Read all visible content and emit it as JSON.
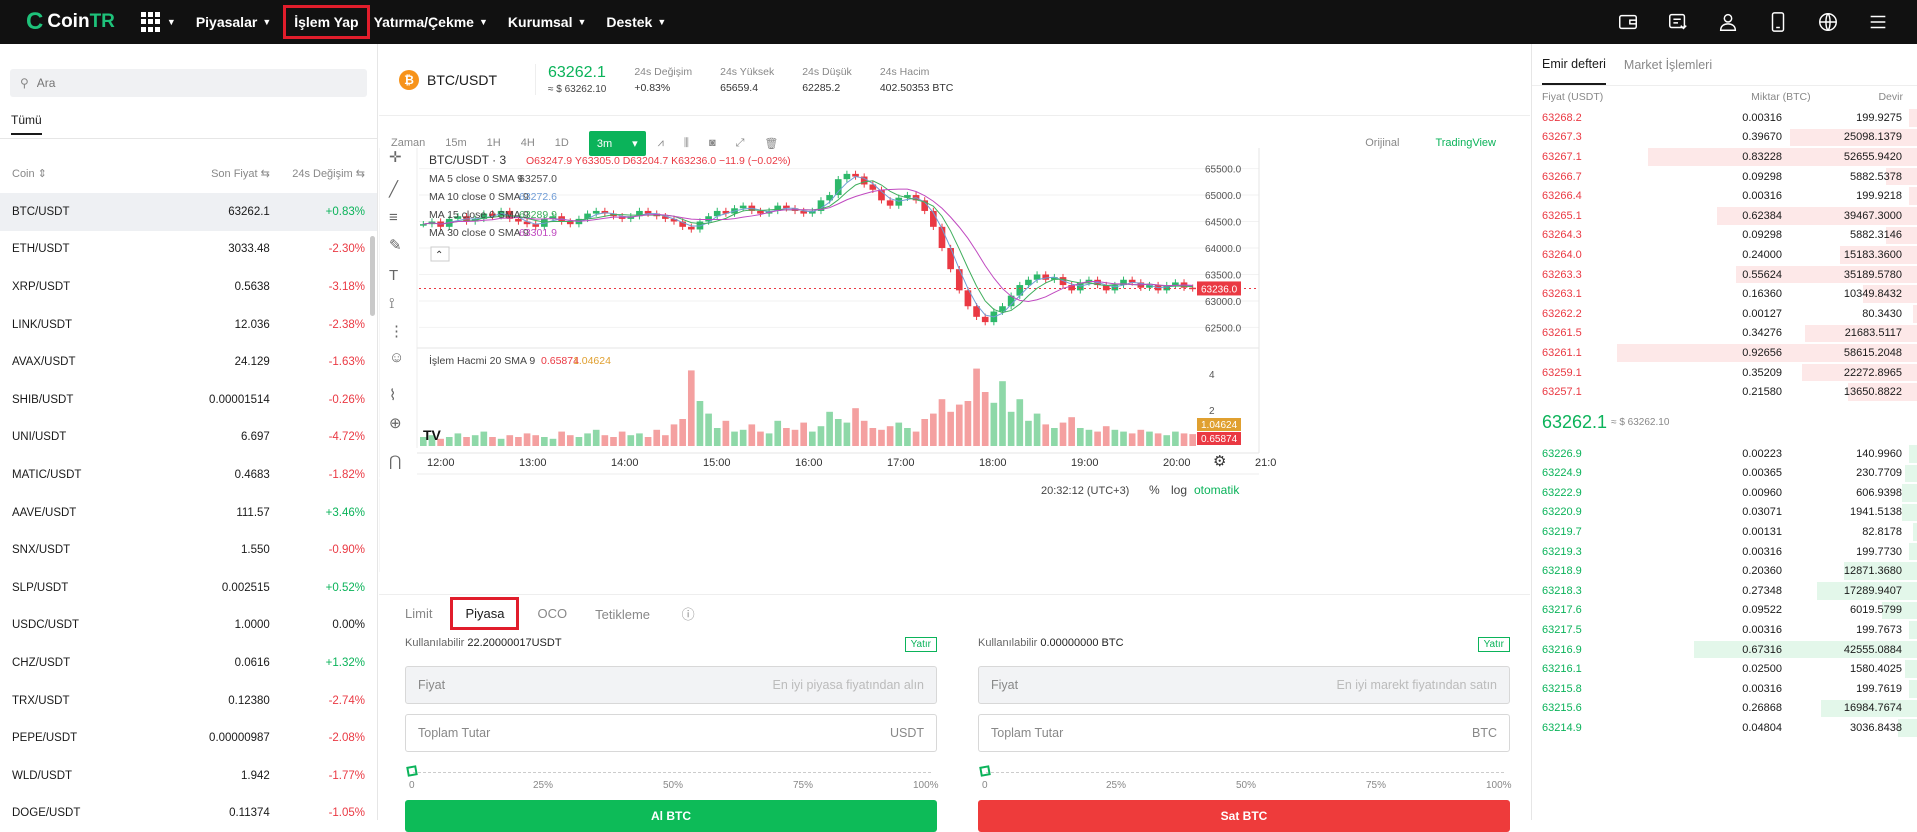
{
  "header": {
    "logo_brand": "Coin",
    "logo_suffix": "TR",
    "nav": [
      "Piyasalar",
      "İşlem Yap",
      "Yatırma/Çekme",
      "Kurumsal",
      "Destek"
    ],
    "icons": [
      "wallet-icon",
      "transfer-icon",
      "user-icon",
      "mobile-icon",
      "globe-icon",
      "menu-icon"
    ]
  },
  "left": {
    "search_placeholder": "Ara",
    "tab": "Tümü",
    "col_coin": "Coin ⇕",
    "col_price": "Son Fiyat ⇆",
    "col_change": "24s Değişim ⇆",
    "coins": [
      [
        "BTC/USDT",
        "63262.1",
        "+0.83%"
      ],
      [
        "ETH/USDT",
        "3033.48",
        "-2.30%"
      ],
      [
        "XRP/USDT",
        "0.5638",
        "-3.18%"
      ],
      [
        "LINK/USDT",
        "12.036",
        "-2.38%"
      ],
      [
        "AVAX/USDT",
        "24.129",
        "-1.63%"
      ],
      [
        "SHIB/USDT",
        "0.00001514",
        "-0.26%"
      ],
      [
        "UNI/USDT",
        "6.697",
        "-4.72%"
      ],
      [
        "MATIC/USDT",
        "0.4683",
        "-1.82%"
      ],
      [
        "AAVE/USDT",
        "111.57",
        "+3.46%"
      ],
      [
        "SNX/USDT",
        "1.550",
        "-0.90%"
      ],
      [
        "SLP/USDT",
        "0.002515",
        "+0.52%"
      ],
      [
        "USDC/USDT",
        "1.0000",
        "0.00%"
      ],
      [
        "CHZ/USDT",
        "0.0616",
        "+1.32%"
      ],
      [
        "TRX/USDT",
        "0.12380",
        "-2.74%"
      ],
      [
        "PEPE/USDT",
        "0.00000987",
        "-2.08%"
      ],
      [
        "WLD/USDT",
        "1.942",
        "-1.77%"
      ],
      [
        "DOGE/USDT",
        "0.11374",
        "-1.05%"
      ]
    ]
  },
  "ticker": {
    "pair": "BTC/USDT",
    "price": "63262.1",
    "price_usd": "≈ $ 63262.10",
    "change_label": "24s Değişim",
    "change": "+0.83%",
    "high_label": "24s Yüksek",
    "high": "65659.4",
    "low_label": "24s Düşük",
    "low": "62285.2",
    "vol_label": "24s Hacim",
    "vol": "402.50353 BTC"
  },
  "toolbar": {
    "zaman": "Zaman",
    "intervals": [
      "15m",
      "1H",
      "4H",
      "1D"
    ],
    "active": "3m",
    "orijinal": "Orijinal",
    "tradingview": "TradingView"
  },
  "chart_data": {
    "type": "candlestick",
    "title": "BTC/USDT · 3",
    "ohlc_text": "O63247.9 Y63305.0 D63204.7 K63236.0 −11.9 (−0.02%)",
    "o": "63247.9",
    "h": "63305.0",
    "l": "63204.7",
    "c": "63236.0",
    "chg": "−11.9 (−0.02%)",
    "ma": [
      {
        "label": "MA 5 close 0 SMA 9",
        "value": "63257.0",
        "color": "#4a4a4a"
      },
      {
        "label": "MA 10 close 0 SMA 9",
        "value": "63272.6",
        "color": "#6f9cd6"
      },
      {
        "label": "MA 15 close 0 SMA 9",
        "value": "63289.9",
        "color": "#3fae5c"
      },
      {
        "label": "MA 30 close 0 SMA 9",
        "value": "63301.9",
        "color": "#c04ac0"
      }
    ],
    "y_ticks": [
      "65500.0",
      "65000.0",
      "64500.0",
      "64000.0",
      "63500.0",
      "63000.0",
      "62500.0"
    ],
    "ylim": [
      62300,
      65700
    ],
    "last_price": "63236.0",
    "x_ticks": [
      "12:00",
      "13:00",
      "14:00",
      "15:00",
      "16:00",
      "17:00",
      "18:00",
      "19:00",
      "20:00",
      "21:0"
    ],
    "close_path": [
      64450,
      64500,
      64400,
      64550,
      64600,
      64500,
      64550,
      64650,
      64600,
      64700,
      64550,
      64500,
      64450,
      64400,
      64550,
      64600,
      64500,
      64450,
      64550,
      64650,
      64700,
      64650,
      64600,
      64550,
      64600,
      64700,
      64650,
      64600,
      64550,
      64500,
      64400,
      64350,
      64500,
      64600,
      64700,
      64650,
      64750,
      64800,
      64700,
      64650,
      64700,
      64800,
      64750,
      64700,
      64650,
      64700,
      64900,
      65000,
      65300,
      65400,
      65350,
      65200,
      65100,
      64900,
      64800,
      64950,
      65000,
      64900,
      64700,
      64400,
      64000,
      63600,
      63200,
      62900,
      62700,
      62600,
      62800,
      62900,
      63100,
      63300,
      63400,
      63500,
      63400,
      63450,
      63300,
      63200,
      63350,
      63400,
      63300,
      63200,
      63300,
      63400,
      63350,
      63250,
      63300,
      63200,
      63300,
      63350,
      63250,
      63236
    ],
    "volume_label": "İşlem Hacmi 20 SMA 9",
    "volume_a": "0.65874",
    "volume_b": "1.04624",
    "vol_ticks": [
      "4",
      "2"
    ],
    "volume": [
      0.5,
      0.6,
      0.4,
      0.5,
      0.7,
      0.5,
      0.6,
      0.8,
      0.5,
      0.4,
      0.6,
      0.5,
      0.7,
      0.6,
      0.5,
      0.4,
      0.8,
      0.6,
      0.5,
      0.7,
      0.9,
      0.6,
      0.5,
      0.8,
      0.6,
      0.7,
      0.5,
      0.9,
      0.6,
      1.2,
      1.5,
      4.2,
      2.5,
      1.8,
      1.0,
      1.4,
      0.8,
      0.9,
      1.2,
      0.8,
      0.7,
      1.4,
      1.0,
      0.9,
      1.3,
      0.8,
      1.1,
      1.9,
      1.5,
      1.3,
      2.1,
      1.4,
      1.0,
      0.9,
      1.1,
      1.3,
      1.0,
      0.8,
      1.5,
      1.8,
      2.6,
      1.9,
      2.3,
      2.5,
      4.3,
      3.0,
      2.4,
      3.6,
      1.9,
      2.6,
      1.4,
      1.8,
      1.2,
      1.0,
      1.3,
      1.6,
      1.0,
      0.9,
      0.8,
      1.1,
      0.9,
      0.8,
      0.7,
      0.9,
      0.8,
      0.7,
      0.6,
      0.8,
      0.7,
      0.66
    ],
    "clock": "20:32:12 (UTC+3)",
    "pct": "%",
    "log": "log",
    "auto": "otomatik"
  },
  "order": {
    "tabs": [
      "Limit",
      "Piyasa",
      "OCO",
      "Tetikleme"
    ],
    "buy": {
      "avail_label": "Kullanılabilir",
      "avail_val": "22.20000017USDT",
      "yatir": "Yatır",
      "fiyat": "Fiyat",
      "fiyat_hint": "En iyi piyasa fiyatından alın",
      "toplam": "Toplam Tutar",
      "unit": "USDT",
      "button": "Al BTC"
    },
    "sell": {
      "avail_label": "Kullanılabilir",
      "avail_val": "0.00000000 BTC",
      "yatir": "Yatır",
      "fiyat": "Fiyat",
      "fiyat_hint": "En iyi marekt fiyatından satın",
      "toplam": "Toplam Tutar",
      "unit": "BTC",
      "button": "Sat BTC"
    },
    "slider_labels": [
      "0",
      "25%",
      "50%",
      "75%",
      "100%"
    ]
  },
  "orderbook": {
    "tabs": [
      "Emir defteri",
      "Market İşlemleri"
    ],
    "cols": [
      "Fiyat (USDT)",
      "Miktar (BTC)",
      "Devir"
    ],
    "asks": [
      [
        "63268.2",
        "0.00316",
        "199.9275",
        0.02
      ],
      [
        "63267.3",
        "0.39670",
        "25098.1379",
        0.33
      ],
      [
        "63267.1",
        "0.83228",
        "52655.9420",
        0.7
      ],
      [
        "63266.7",
        "0.09298",
        "5882.5378",
        0.08
      ],
      [
        "63266.4",
        "0.00316",
        "199.9218",
        0.02
      ],
      [
        "63265.1",
        "0.62384",
        "39467.3000",
        0.52
      ],
      [
        "63264.3",
        "0.09298",
        "5882.3146",
        0.08
      ],
      [
        "63264.0",
        "0.24000",
        "15183.3600",
        0.2
      ],
      [
        "63263.3",
        "0.55624",
        "35189.5780",
        0.47
      ],
      [
        "63263.1",
        "0.16360",
        "10349.8432",
        0.14
      ],
      [
        "63262.2",
        "0.00127",
        "80.3430",
        0.01
      ],
      [
        "63261.5",
        "0.34276",
        "21683.5117",
        0.29
      ],
      [
        "63261.1",
        "0.92656",
        "58615.2048",
        0.78
      ],
      [
        "63259.1",
        "0.35209",
        "22272.8965",
        0.3
      ],
      [
        "63257.1",
        "0.21580",
        "13650.8822",
        0.18
      ]
    ],
    "mid_price": "63262.1",
    "mid_usd": "≈ $ 63262.10",
    "bids": [
      [
        "63226.9",
        "0.00223",
        "140.9960",
        0.02
      ],
      [
        "63224.9",
        "0.00365",
        "230.7709",
        0.03
      ],
      [
        "63222.9",
        "0.00960",
        "606.9398",
        0.04
      ],
      [
        "63220.9",
        "0.03071",
        "1941.5138",
        0.04
      ],
      [
        "63219.7",
        "0.00131",
        "82.8178",
        0.01
      ],
      [
        "63219.3",
        "0.00316",
        "199.7730",
        0.02
      ],
      [
        "63218.9",
        "0.20360",
        "12871.3680",
        0.19
      ],
      [
        "63218.3",
        "0.27348",
        "17289.9407",
        0.26
      ],
      [
        "63217.6",
        "0.09522",
        "6019.5799",
        0.09
      ],
      [
        "63217.5",
        "0.00316",
        "199.7673",
        0.02
      ],
      [
        "63216.9",
        "0.67316",
        "42555.0884",
        0.58
      ],
      [
        "63216.1",
        "0.02500",
        "1580.4025",
        0.03
      ],
      [
        "63215.8",
        "0.00316",
        "199.7619",
        0.02
      ],
      [
        "63215.6",
        "0.26868",
        "16984.7674",
        0.25
      ],
      [
        "63214.9",
        "0.04804",
        "3036.8438",
        0.05
      ]
    ]
  }
}
